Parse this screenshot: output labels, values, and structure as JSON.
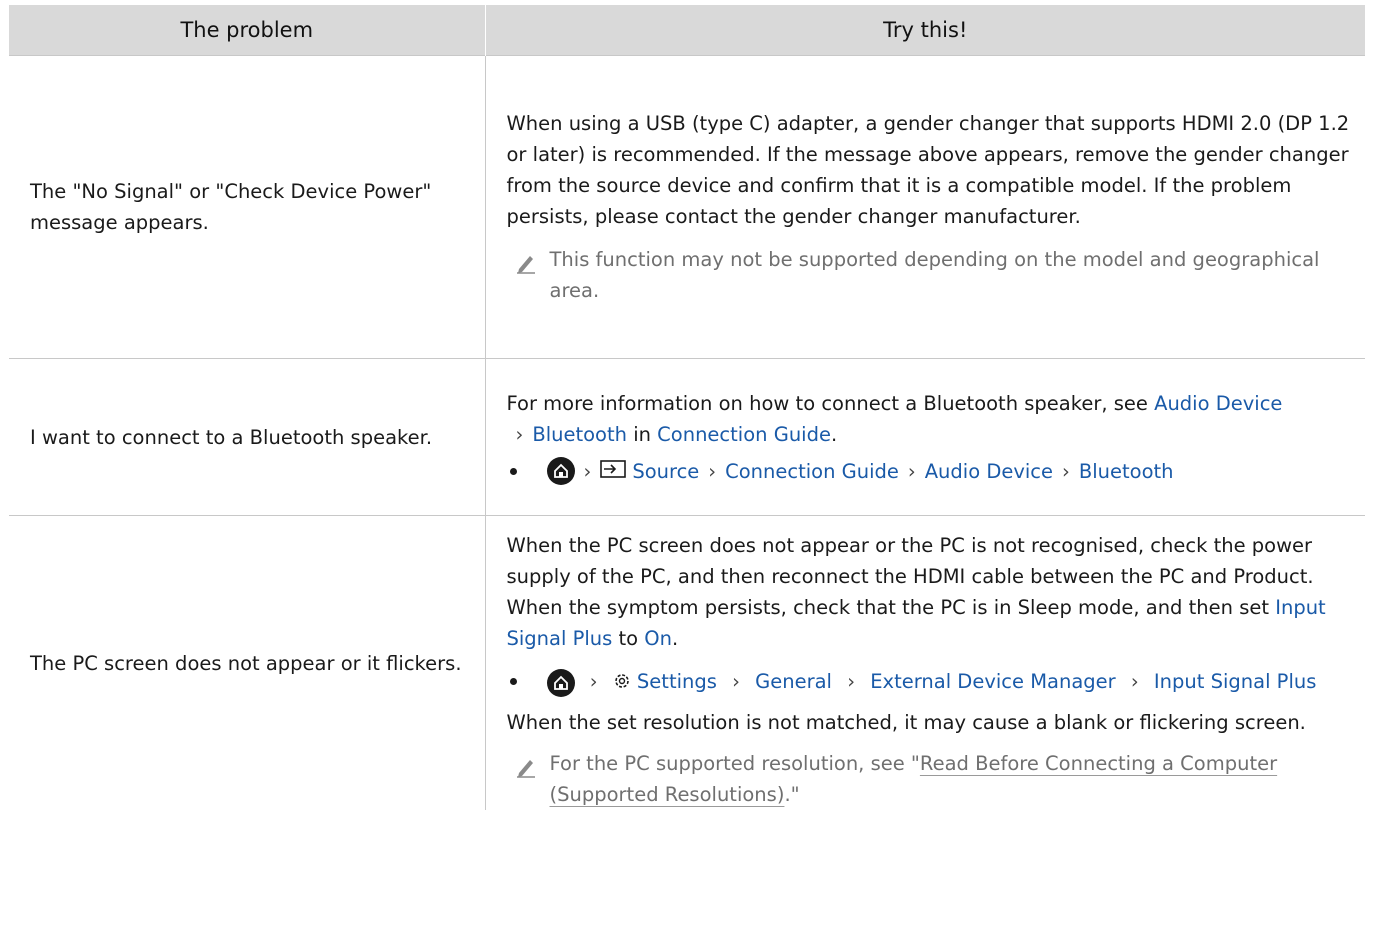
{
  "table": {
    "headers": [
      "The problem",
      "Try this!"
    ],
    "rows": [
      {
        "problem": "The \"No Signal\" or \"Check Device Power\" message appears.",
        "paragraph": "When using a USB (type C) adapter, a gender changer that supports HDMI 2.0 (DP 1.2 or later) is recommended. If the message above appears, remove the gender changer from the source device and confirm that it is a compatible model. If the problem persists, please contact the gender changer manufacturer.",
        "note": "This function may not be supported depending on the model and geographical area."
      },
      {
        "problem": "I want to connect to a Bluetooth speaker.",
        "intro": "For more information on how to connect a Bluetooth speaker, see",
        "link1": "Audio Device",
        "link2": "Bluetooth",
        "in_word": "in",
        "link3": "Connection Guide",
        "end": ".",
        "path": [
          "Source",
          "Connection Guide",
          "Audio Device",
          "Bluetooth"
        ]
      },
      {
        "problem": "The PC screen does not appear or it flickers.",
        "paragraph": "When the PC screen does not appear or the PC is not recognised, check the power supply of the PC, and then reconnect the HDMI cable between the PC and Product. When the symptom persists, check that the PC is in Sleep mode, and then set",
        "link_a": "Input Signal Plus",
        "to_word": "to",
        "link_b": "On",
        "end": ".",
        "path": [
          "Settings",
          "General",
          "External Device Manager",
          "Input Signal Plus"
        ],
        "paragraph2": "When the set resolution is not matched, it may cause a blank or flickering screen.",
        "note_pre": "For the PC supported resolution, see \"",
        "note_link": "Read Before Connecting a Computer (Supported Resolutions)",
        "note_post": ".\""
      }
    ]
  },
  "colors": {
    "link": "#1a5aa8",
    "header_bg": "#d9d9d9",
    "note": "#6f6f6f"
  },
  "icons": [
    "home-icon",
    "source-icon",
    "settings-icon",
    "note-pencil-icon",
    "chevron-right-icon"
  ]
}
